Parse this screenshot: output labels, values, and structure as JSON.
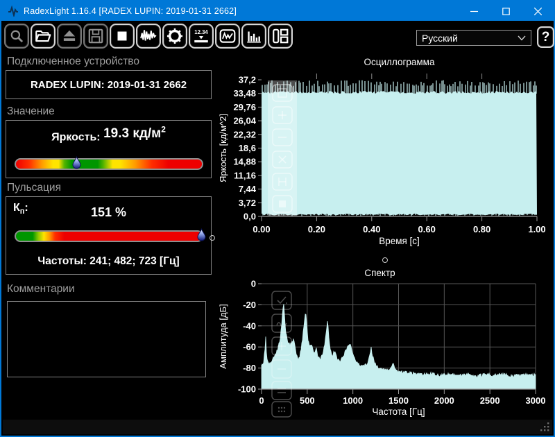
{
  "window": {
    "title": "RadexLight 1.16.4 [RADEX LUPIN: 2019-01-31 2662]"
  },
  "colors": {
    "titlebar": "#0078d7",
    "window_border": "#0078d7",
    "chart_fill": "#c7efef",
    "grid": "#575757"
  },
  "toolbar": {
    "buttons": [
      {
        "icon": "magnifier-icon",
        "enabled": false
      },
      {
        "icon": "open-folder-icon",
        "enabled": true
      },
      {
        "icon": "eject-icon",
        "enabled": false
      },
      {
        "icon": "save-icon",
        "enabled": false
      },
      {
        "icon": "stop-icon",
        "enabled": true
      },
      {
        "icon": "oscillogram-icon",
        "enabled": true
      },
      {
        "icon": "gear-icon",
        "enabled": true
      },
      {
        "icon": "numeric-display-icon",
        "enabled": true,
        "text": "12.34"
      },
      {
        "icon": "waveform-box-icon",
        "enabled": true
      },
      {
        "icon": "spectrum-bars-icon",
        "enabled": true
      },
      {
        "icon": "layout-icon",
        "enabled": true
      }
    ],
    "language": {
      "value": "Русский"
    },
    "help": "?"
  },
  "panels": {
    "device": {
      "header": "Подключенное устройство",
      "name": "RADEX LUPIN: 2019-01-31 2662"
    },
    "value": {
      "header": "Значение",
      "label": "Яркость:",
      "value": "19.3",
      "unit": " кд/м",
      "unit_exp": "2",
      "marker_pct": 33
    },
    "pulsation": {
      "header": "Пульсация",
      "kp_base": "К",
      "kp_sub": "п",
      "kp_colon": ":",
      "value": "151 %",
      "marker_pct": 99,
      "frequencies": "Частоты: 241; 482; 723 [Гц]"
    },
    "comments": {
      "header": "Комментарии",
      "text": ""
    }
  },
  "chart_data": [
    {
      "type": "area",
      "title": "Осциллограмма",
      "xlabel": "Время [с]",
      "ylabel": "Яркость [кд/м^2]",
      "xlim": [
        0,
        1
      ],
      "ylim": [
        0,
        37.2
      ],
      "x_ticks": [
        "0.00",
        "0.20",
        "0.40",
        "0.60",
        "0.80",
        "1.00"
      ],
      "y_ticks": [
        "0,0",
        "3,72",
        "7,44",
        "11,16",
        "14,88",
        "18,6",
        "22,32",
        "26,04",
        "29,76",
        "33,48",
        "37,2"
      ],
      "grid": false,
      "dominant_frequencies_hz": [
        241,
        482,
        723
      ],
      "description": "плотный пульсирующий сигнал, заполняющий диапазон ~0.3–37 кд/м^2 на всём интервале 1 с",
      "envelope_top": [
        33.5,
        37.2
      ],
      "envelope_bottom": [
        0.1,
        1.4
      ],
      "fill_color": "#c7efef"
    },
    {
      "type": "area",
      "title": "Спектр",
      "xlabel": "Частота [Гц]",
      "ylabel": "Амплитуда [дБ]",
      "xlim": [
        0,
        3000
      ],
      "ylim": [
        -100,
        0
      ],
      "x_ticks": [
        "0",
        "500",
        "1000",
        "1500",
        "2000",
        "2500",
        "3000"
      ],
      "y_ticks": [
        "0",
        "-20",
        "-40",
        "-60",
        "-80",
        "-100"
      ],
      "grid": true,
      "main_peaks": [
        [
          241,
          -18
        ],
        [
          482,
          -26
        ],
        [
          723,
          -36
        ]
      ],
      "noise_floor_db": -87,
      "envelope_points": [
        [
          0,
          -78
        ],
        [
          20,
          -76
        ],
        [
          40,
          -60
        ],
        [
          48,
          -48
        ],
        [
          55,
          -70
        ],
        [
          80,
          -76
        ],
        [
          120,
          -72
        ],
        [
          160,
          -66
        ],
        [
          200,
          -55
        ],
        [
          220,
          -38
        ],
        [
          235,
          -24
        ],
        [
          241,
          -18
        ],
        [
          250,
          -28
        ],
        [
          265,
          -45
        ],
        [
          285,
          -55
        ],
        [
          310,
          -58
        ],
        [
          340,
          -55
        ],
        [
          355,
          -52
        ],
        [
          375,
          -65
        ],
        [
          400,
          -72
        ],
        [
          420,
          -68
        ],
        [
          445,
          -55
        ],
        [
          465,
          -38
        ],
        [
          482,
          -26
        ],
        [
          495,
          -38
        ],
        [
          510,
          -55
        ],
        [
          530,
          -60
        ],
        [
          555,
          -58
        ],
        [
          575,
          -66
        ],
        [
          600,
          -60
        ],
        [
          615,
          -68
        ],
        [
          640,
          -72
        ],
        [
          665,
          -68
        ],
        [
          695,
          -55
        ],
        [
          710,
          -45
        ],
        [
          723,
          -36
        ],
        [
          735,
          -48
        ],
        [
          750,
          -60
        ],
        [
          775,
          -68
        ],
        [
          800,
          -64
        ],
        [
          825,
          -70
        ],
        [
          850,
          -74
        ],
        [
          875,
          -71
        ],
        [
          900,
          -68
        ],
        [
          930,
          -62
        ],
        [
          955,
          -58
        ],
        [
          965,
          -57
        ],
        [
          985,
          -62
        ],
        [
          1010,
          -68
        ],
        [
          1040,
          -74
        ],
        [
          1080,
          -77
        ],
        [
          1120,
          -78
        ],
        [
          1160,
          -76
        ],
        [
          1190,
          -65
        ],
        [
          1200,
          -61
        ],
        [
          1215,
          -68
        ],
        [
          1240,
          -76
        ],
        [
          1280,
          -80
        ],
        [
          1330,
          -81
        ],
        [
          1380,
          -82
        ],
        [
          1430,
          -78
        ],
        [
          1445,
          -74
        ],
        [
          1460,
          -80
        ],
        [
          1500,
          -83
        ],
        [
          1550,
          -84
        ],
        [
          1650,
          -85
        ],
        [
          1750,
          -86
        ],
        [
          1850,
          -85
        ],
        [
          1950,
          -87
        ],
        [
          2050,
          -86
        ],
        [
          2150,
          -87
        ],
        [
          2250,
          -86
        ],
        [
          2350,
          -88
        ],
        [
          2450,
          -86
        ],
        [
          2550,
          -87
        ],
        [
          2650,
          -86
        ],
        [
          2750,
          -88
        ],
        [
          2850,
          -86
        ],
        [
          2950,
          -87
        ],
        [
          3000,
          -86
        ]
      ],
      "fill_color": "#c7efef"
    }
  ]
}
